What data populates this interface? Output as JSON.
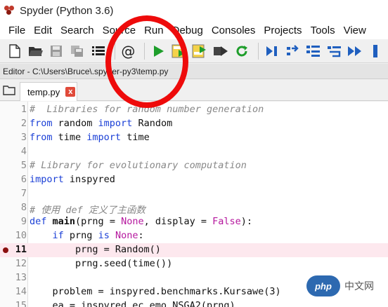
{
  "window": {
    "title": "Spyder (Python 3.6)"
  },
  "menu": [
    "File",
    "Edit",
    "Search",
    "Source",
    "Run",
    "Debug",
    "Consoles",
    "Projects",
    "Tools",
    "View"
  ],
  "toolbar": {
    "buttons": [
      "new-file-icon",
      "open-file-icon",
      "save-file-icon",
      "save-all-icon",
      "file-list-icon",
      "at-sign-icon",
      "run-file-icon",
      "run-cell-icon",
      "run-cell-advance-icon",
      "run-selection-icon",
      "rerun-last-icon",
      "debug-icon",
      "step-icon",
      "step-into-icon",
      "step-return-icon",
      "continue-icon",
      "stop-debug-icon"
    ],
    "at_glyph": "@"
  },
  "editor": {
    "path": "Editor - C:\\Users\\Bruce\\.spyder-py3\\temp.py",
    "tab_label": "temp.py",
    "tab_close": "x",
    "current_line": 11,
    "breakpoint_line": 11
  },
  "code_lines": [
    {
      "n": "1",
      "segs": [
        {
          "c": "cm",
          "t": "#  Libraries for random number generation"
        }
      ]
    },
    {
      "n": "2",
      "segs": [
        {
          "c": "kw",
          "t": "from"
        },
        {
          "c": "",
          "t": " random "
        },
        {
          "c": "kw",
          "t": "import"
        },
        {
          "c": "",
          "t": " Random"
        }
      ]
    },
    {
      "n": "3",
      "segs": [
        {
          "c": "kw",
          "t": "from"
        },
        {
          "c": "",
          "t": " time "
        },
        {
          "c": "kw",
          "t": "import"
        },
        {
          "c": "",
          "t": " time"
        }
      ]
    },
    {
      "n": "4",
      "segs": []
    },
    {
      "n": "5",
      "segs": [
        {
          "c": "cm",
          "t": "# Library for evolutionary computation"
        }
      ]
    },
    {
      "n": "6",
      "segs": [
        {
          "c": "kw",
          "t": "import"
        },
        {
          "c": "",
          "t": " inspyred"
        }
      ]
    },
    {
      "n": "7",
      "segs": []
    },
    {
      "n": "8",
      "segs": [
        {
          "c": "cm",
          "t": "# 使用 def 定义了主函数"
        }
      ]
    },
    {
      "n": "9",
      "segs": [
        {
          "c": "kw",
          "t": "def"
        },
        {
          "c": "",
          "t": " "
        },
        {
          "c": "fn",
          "t": "main"
        },
        {
          "c": "",
          "t": "(prng = "
        },
        {
          "c": "cst",
          "t": "None"
        },
        {
          "c": "",
          "t": ", display = "
        },
        {
          "c": "cst",
          "t": "False"
        },
        {
          "c": "",
          "t": "):"
        }
      ]
    },
    {
      "n": "10",
      "segs": [
        {
          "c": "",
          "t": "    "
        },
        {
          "c": "kw",
          "t": "if"
        },
        {
          "c": "",
          "t": " prng "
        },
        {
          "c": "kw",
          "t": "is"
        },
        {
          "c": "",
          "t": " "
        },
        {
          "c": "cst",
          "t": "None"
        },
        {
          "c": "",
          "t": ":"
        }
      ]
    },
    {
      "n": "11",
      "segs": [
        {
          "c": "",
          "t": "        prng = Random()"
        }
      ]
    },
    {
      "n": "12",
      "segs": [
        {
          "c": "",
          "t": "        prng.seed(time())"
        }
      ]
    },
    {
      "n": "13",
      "segs": []
    },
    {
      "n": "14",
      "segs": [
        {
          "c": "",
          "t": "    problem = inspyred.benchmarks.Kursawe(3)"
        }
      ]
    },
    {
      "n": "15",
      "segs": [
        {
          "c": "",
          "t": "    ea = inspyred.ec.emo.NSGA2(prng)"
        }
      ]
    }
  ],
  "watermark": {
    "logo": "php",
    "text": "中文网"
  },
  "colors": {
    "keyword": "#1a3fd6",
    "comment": "#888888",
    "constant": "#b5179e",
    "highlight": "#fde8ee",
    "annotation_circle": "#ee0b0b"
  }
}
